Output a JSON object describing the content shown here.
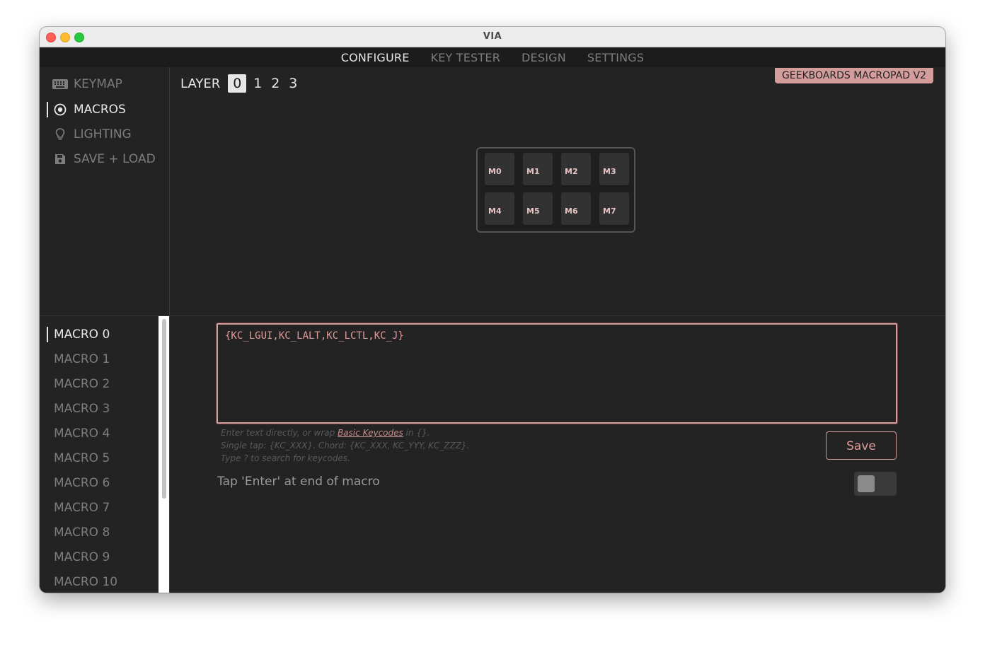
{
  "window": {
    "title": "VIA"
  },
  "nav": {
    "tabs": [
      "CONFIGURE",
      "KEY TESTER",
      "DESIGN",
      "SETTINGS"
    ],
    "active": "CONFIGURE"
  },
  "menu": {
    "items": [
      {
        "label": "KEYMAP",
        "icon": "keyboard-icon"
      },
      {
        "label": "MACROS",
        "icon": "macro-circle-icon"
      },
      {
        "label": "LIGHTING",
        "icon": "lightbulb-icon"
      },
      {
        "label": "SAVE + LOAD",
        "icon": "floppy-disk-icon"
      }
    ],
    "active": "MACROS"
  },
  "layers": {
    "label": "LAYER",
    "items": [
      "0",
      "1",
      "2",
      "3"
    ],
    "active": "0"
  },
  "device": {
    "name": "GEEKBOARDS MACROPAD V2"
  },
  "keyboard": {
    "keys": [
      "M0",
      "M1",
      "M2",
      "M3",
      "M4",
      "M5",
      "M6",
      "M7"
    ]
  },
  "macros": {
    "items": [
      "MACRO 0",
      "MACRO 1",
      "MACRO 2",
      "MACRO 3",
      "MACRO 4",
      "MACRO 5",
      "MACRO 6",
      "MACRO 7",
      "MACRO 8",
      "MACRO 9",
      "MACRO 10"
    ],
    "active": "MACRO 0"
  },
  "editor": {
    "value": "{KC_LGUI,KC_LALT,KC_LCTL,KC_J}",
    "hint_line1_pre": "Enter text directly, or wrap ",
    "hint_link": "Basic Keycodes",
    "hint_line1_post": " in {}.",
    "hint_line2": "Single tap: {KC_XXX}. Chord: {KC_XXX, KC_YYY, KC_ZZZ}.",
    "hint_line3": "Type ? to search for keycodes.",
    "save_label": "Save",
    "enter_label": "Tap 'Enter' at end of macro",
    "enter_toggle_on": false
  },
  "colors": {
    "accent": "#d59c9c",
    "background": "#232323",
    "text_active": "#e6e6e6",
    "text_muted": "#7d7d7d"
  }
}
